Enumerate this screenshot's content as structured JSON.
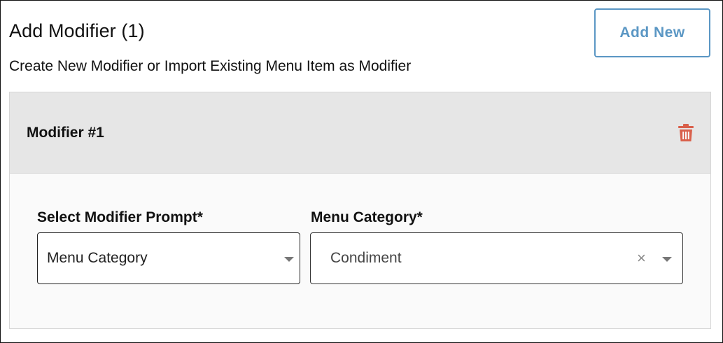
{
  "header": {
    "title": "Add Modifier (1)",
    "subtitle": "Create New Modifier or Import Existing Menu Item as Modifier",
    "add_button_label": "Add New"
  },
  "modifier": {
    "title": "Modifier #1",
    "delete_icon": "trash-icon",
    "prompt_label": "Select Modifier Prompt*",
    "prompt_value": "Menu Category",
    "category_label": "Menu Category*",
    "category_value": "Condiment",
    "clear_symbol": "×"
  },
  "colors": {
    "accent": "#5b97c4",
    "delete": "#d9604b",
    "header_bg": "#e6e6e6",
    "card_bg": "#fafafa"
  }
}
